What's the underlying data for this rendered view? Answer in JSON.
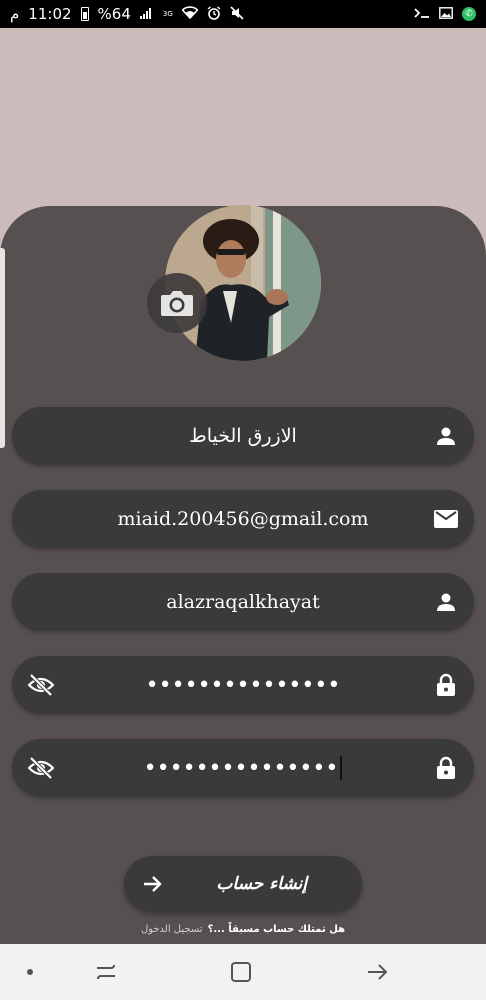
{
  "status_bar": {
    "time": "11:02",
    "ampm": "م",
    "battery": "%64",
    "network": "3G"
  },
  "profile": {
    "avatar_alt": "profile photo",
    "camera_button": "camera-icon"
  },
  "fields": [
    {
      "id": "name",
      "value": "الازرق الخياط",
      "icon": "person-icon"
    },
    {
      "id": "email",
      "value": "miaid.200456@gmail.com",
      "icon": "mail-icon"
    },
    {
      "id": "username",
      "value": "alazraqalkhayat",
      "icon": "person-icon"
    },
    {
      "id": "password",
      "value": "•••••••••••••••",
      "icon": "lock-icon",
      "toggle": "eye-off-icon"
    },
    {
      "id": "confirm_password",
      "value": "•••••••••••••••",
      "icon": "lock-icon",
      "toggle": "eye-off-icon"
    }
  ],
  "submit": {
    "label": "إنشاء حساب",
    "icon": "arrow-right-icon"
  },
  "login_prompt": {
    "question": "هل تمتلك حساب مسبقاً ...؟",
    "link": "تسجيل الدخول"
  },
  "colors": {
    "background": "#cbbcbb",
    "card": "#575050",
    "field": "#3a3a3a"
  }
}
